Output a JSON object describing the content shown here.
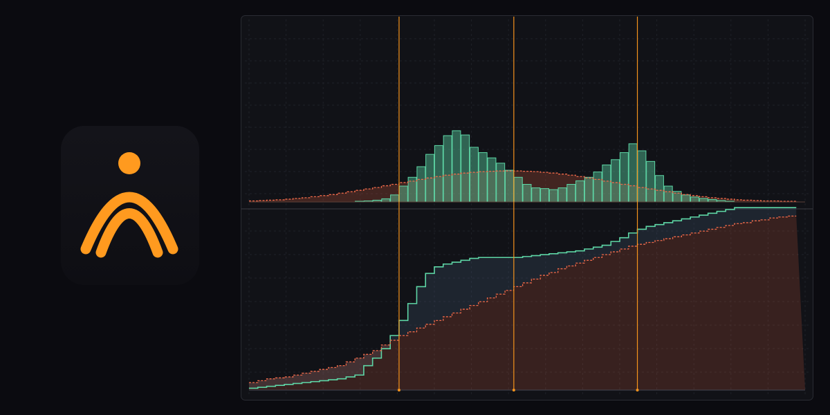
{
  "logo": {
    "icon": "bridge-person-logo-icon",
    "color": "#ff9a1f"
  },
  "chart_data": [
    {
      "type": "bar",
      "panel": "top",
      "grid": true,
      "series": [
        {
          "type": "bar",
          "color": "#5ed7a6",
          "values": [
            0,
            0,
            0,
            0,
            0,
            0,
            0,
            0,
            0,
            0,
            0,
            0,
            0.2,
            0.3,
            0.5,
            0.9,
            2.0,
            4.5,
            7.0,
            10.0,
            13.5,
            16.0,
            18.8,
            20.2,
            19.0,
            15.5,
            14.0,
            12.5,
            11.0,
            9.0,
            7.0,
            5.0,
            4.0,
            3.8,
            3.5,
            4.0,
            5.0,
            6.0,
            7.0,
            8.5,
            10.5,
            12.0,
            14.0,
            16.5,
            14.5,
            11.5,
            7.5,
            4.5,
            3.0,
            2.0,
            1.4,
            1.0,
            0.7,
            0.4,
            0.2,
            0,
            0,
            0,
            0,
            0,
            0,
            0,
            0
          ]
        },
        {
          "type": "step",
          "style": "dashed",
          "color": "#f06a4a",
          "values": [
            0.3,
            0.4,
            0.5,
            0.6,
            0.8,
            1.0,
            1.2,
            1.5,
            1.8,
            2.1,
            2.5,
            2.9,
            3.3,
            3.7,
            4.1,
            4.6,
            5.0,
            5.5,
            5.9,
            6.4,
            6.8,
            7.2,
            7.6,
            7.9,
            8.2,
            8.4,
            8.6,
            8.7,
            8.8,
            8.8,
            8.8,
            8.7,
            8.6,
            8.4,
            8.2,
            7.9,
            7.6,
            7.2,
            6.8,
            6.4,
            5.9,
            5.5,
            5.0,
            4.6,
            4.1,
            3.7,
            3.3,
            2.9,
            2.5,
            2.1,
            1.8,
            1.5,
            1.2,
            1.0,
            0.8,
            0.6,
            0.5,
            0.4,
            0.3,
            0.3,
            0.2,
            0.2
          ]
        }
      ],
      "markers": [
        17,
        30,
        44
      ],
      "marker_color": "#f7941d"
    },
    {
      "type": "line",
      "panel": "bottom",
      "grid": true,
      "series": [
        {
          "type": "step",
          "color": "#5ed7a6",
          "values": [
            0.01,
            0.015,
            0.02,
            0.025,
            0.03,
            0.035,
            0.04,
            0.045,
            0.05,
            0.055,
            0.06,
            0.07,
            0.08,
            0.13,
            0.17,
            0.22,
            0.29,
            0.37,
            0.46,
            0.55,
            0.62,
            0.655,
            0.67,
            0.68,
            0.69,
            0.7,
            0.705,
            0.705,
            0.705,
            0.705,
            0.705,
            0.71,
            0.715,
            0.72,
            0.725,
            0.73,
            0.735,
            0.74,
            0.75,
            0.76,
            0.77,
            0.79,
            0.81,
            0.835,
            0.855,
            0.87,
            0.88,
            0.89,
            0.9,
            0.91,
            0.92,
            0.93,
            0.94,
            0.95,
            0.96,
            0.97,
            0.97,
            0.97,
            0.97,
            0.97,
            0.97,
            0.97
          ]
        },
        {
          "type": "step",
          "style": "dashed",
          "color": "#f06a4a",
          "values": [
            0.04,
            0.05,
            0.06,
            0.065,
            0.07,
            0.08,
            0.09,
            0.1,
            0.11,
            0.12,
            0.13,
            0.15,
            0.17,
            0.19,
            0.21,
            0.24,
            0.265,
            0.29,
            0.31,
            0.33,
            0.35,
            0.37,
            0.39,
            0.41,
            0.43,
            0.45,
            0.47,
            0.49,
            0.51,
            0.53,
            0.55,
            0.57,
            0.59,
            0.61,
            0.625,
            0.645,
            0.66,
            0.675,
            0.69,
            0.705,
            0.72,
            0.735,
            0.75,
            0.765,
            0.775,
            0.785,
            0.795,
            0.805,
            0.815,
            0.825,
            0.835,
            0.845,
            0.855,
            0.865,
            0.875,
            0.885,
            0.89,
            0.9,
            0.905,
            0.915,
            0.92,
            0.925
          ]
        }
      ],
      "markers": [
        17,
        30,
        44
      ],
      "marker_color": "#f7941d"
    }
  ]
}
